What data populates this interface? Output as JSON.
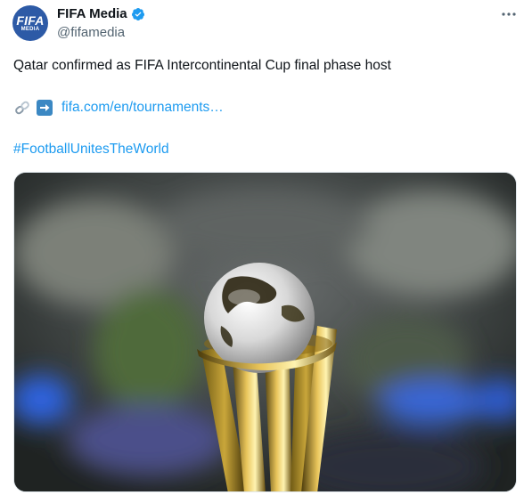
{
  "author": {
    "name": "FIFA Media",
    "handle": "@fifamedia",
    "avatar_text": "FIFA",
    "avatar_subtext": "MEDIA"
  },
  "tweet": {
    "text": "Qatar confirmed as FIFA Intercontinental Cup final phase host",
    "link": "fifa.com/en/tournaments…",
    "hashtag": "#FootballUnitesTheWorld"
  },
  "icons": {
    "verified": "verified-badge-icon",
    "more": "more-options-icon",
    "link": "linked-paperclip-icon",
    "arrow": "right-arrow-icon"
  },
  "colors": {
    "link": "#1d9bf0",
    "verified": "#1d9bf0",
    "handle": "#536471",
    "avatar": "#2d5aa6"
  }
}
